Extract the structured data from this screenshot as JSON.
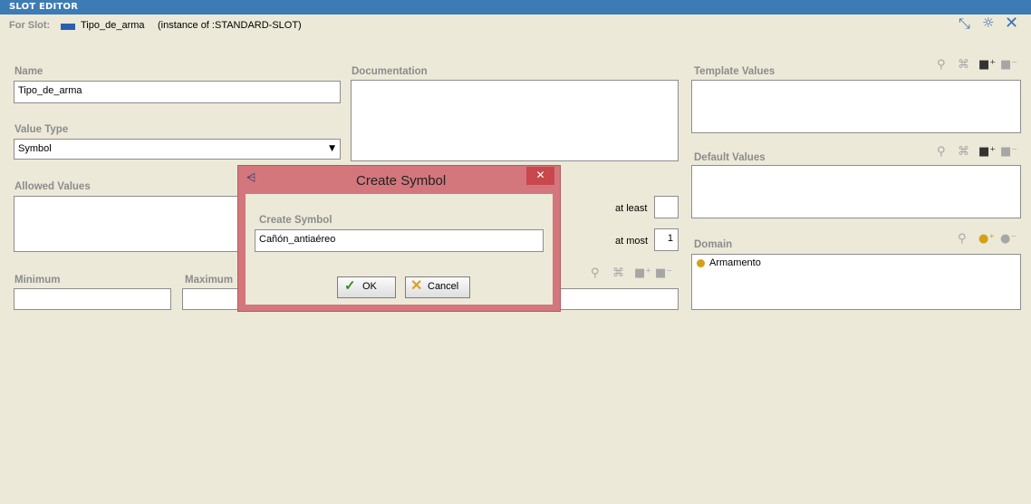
{
  "window": {
    "title": "SLOT EDITOR"
  },
  "for_slot": {
    "label": "For Slot:",
    "slot_name": "Tipo_de_arma",
    "instance": "(instance of :STANDARD-SLOT)"
  },
  "fields": {
    "name_label": "Name",
    "name_value": "Tipo_de_arma",
    "documentation_label": "Documentation",
    "template_values_label": "Template Values",
    "value_type_label": "Value Type",
    "value_type_value": "Symbol",
    "default_values_label": "Default Values",
    "allowed_values_label": "Allowed Values",
    "at_least_label": "at least",
    "at_least_value": "",
    "at_most_label": "at most",
    "at_most_value": "1",
    "domain_label": "Domain",
    "domain_items": [
      "Armamento"
    ],
    "minimum_label": "Minimum",
    "maximum_label": "Maximum"
  },
  "dialog": {
    "title": "Create Symbol",
    "field_label": "Create Symbol",
    "input_value": "Cañón_antiaéreo",
    "ok_label": "OK",
    "cancel_label": "Cancel",
    "close_glyph": "✕"
  },
  "colors": {
    "titlebar": "#3d7bb5",
    "background": "#ece9d8",
    "dialog_border": "#d3777c",
    "label_gray": "#8c8c8c",
    "domain_dot": "#d4a017"
  }
}
